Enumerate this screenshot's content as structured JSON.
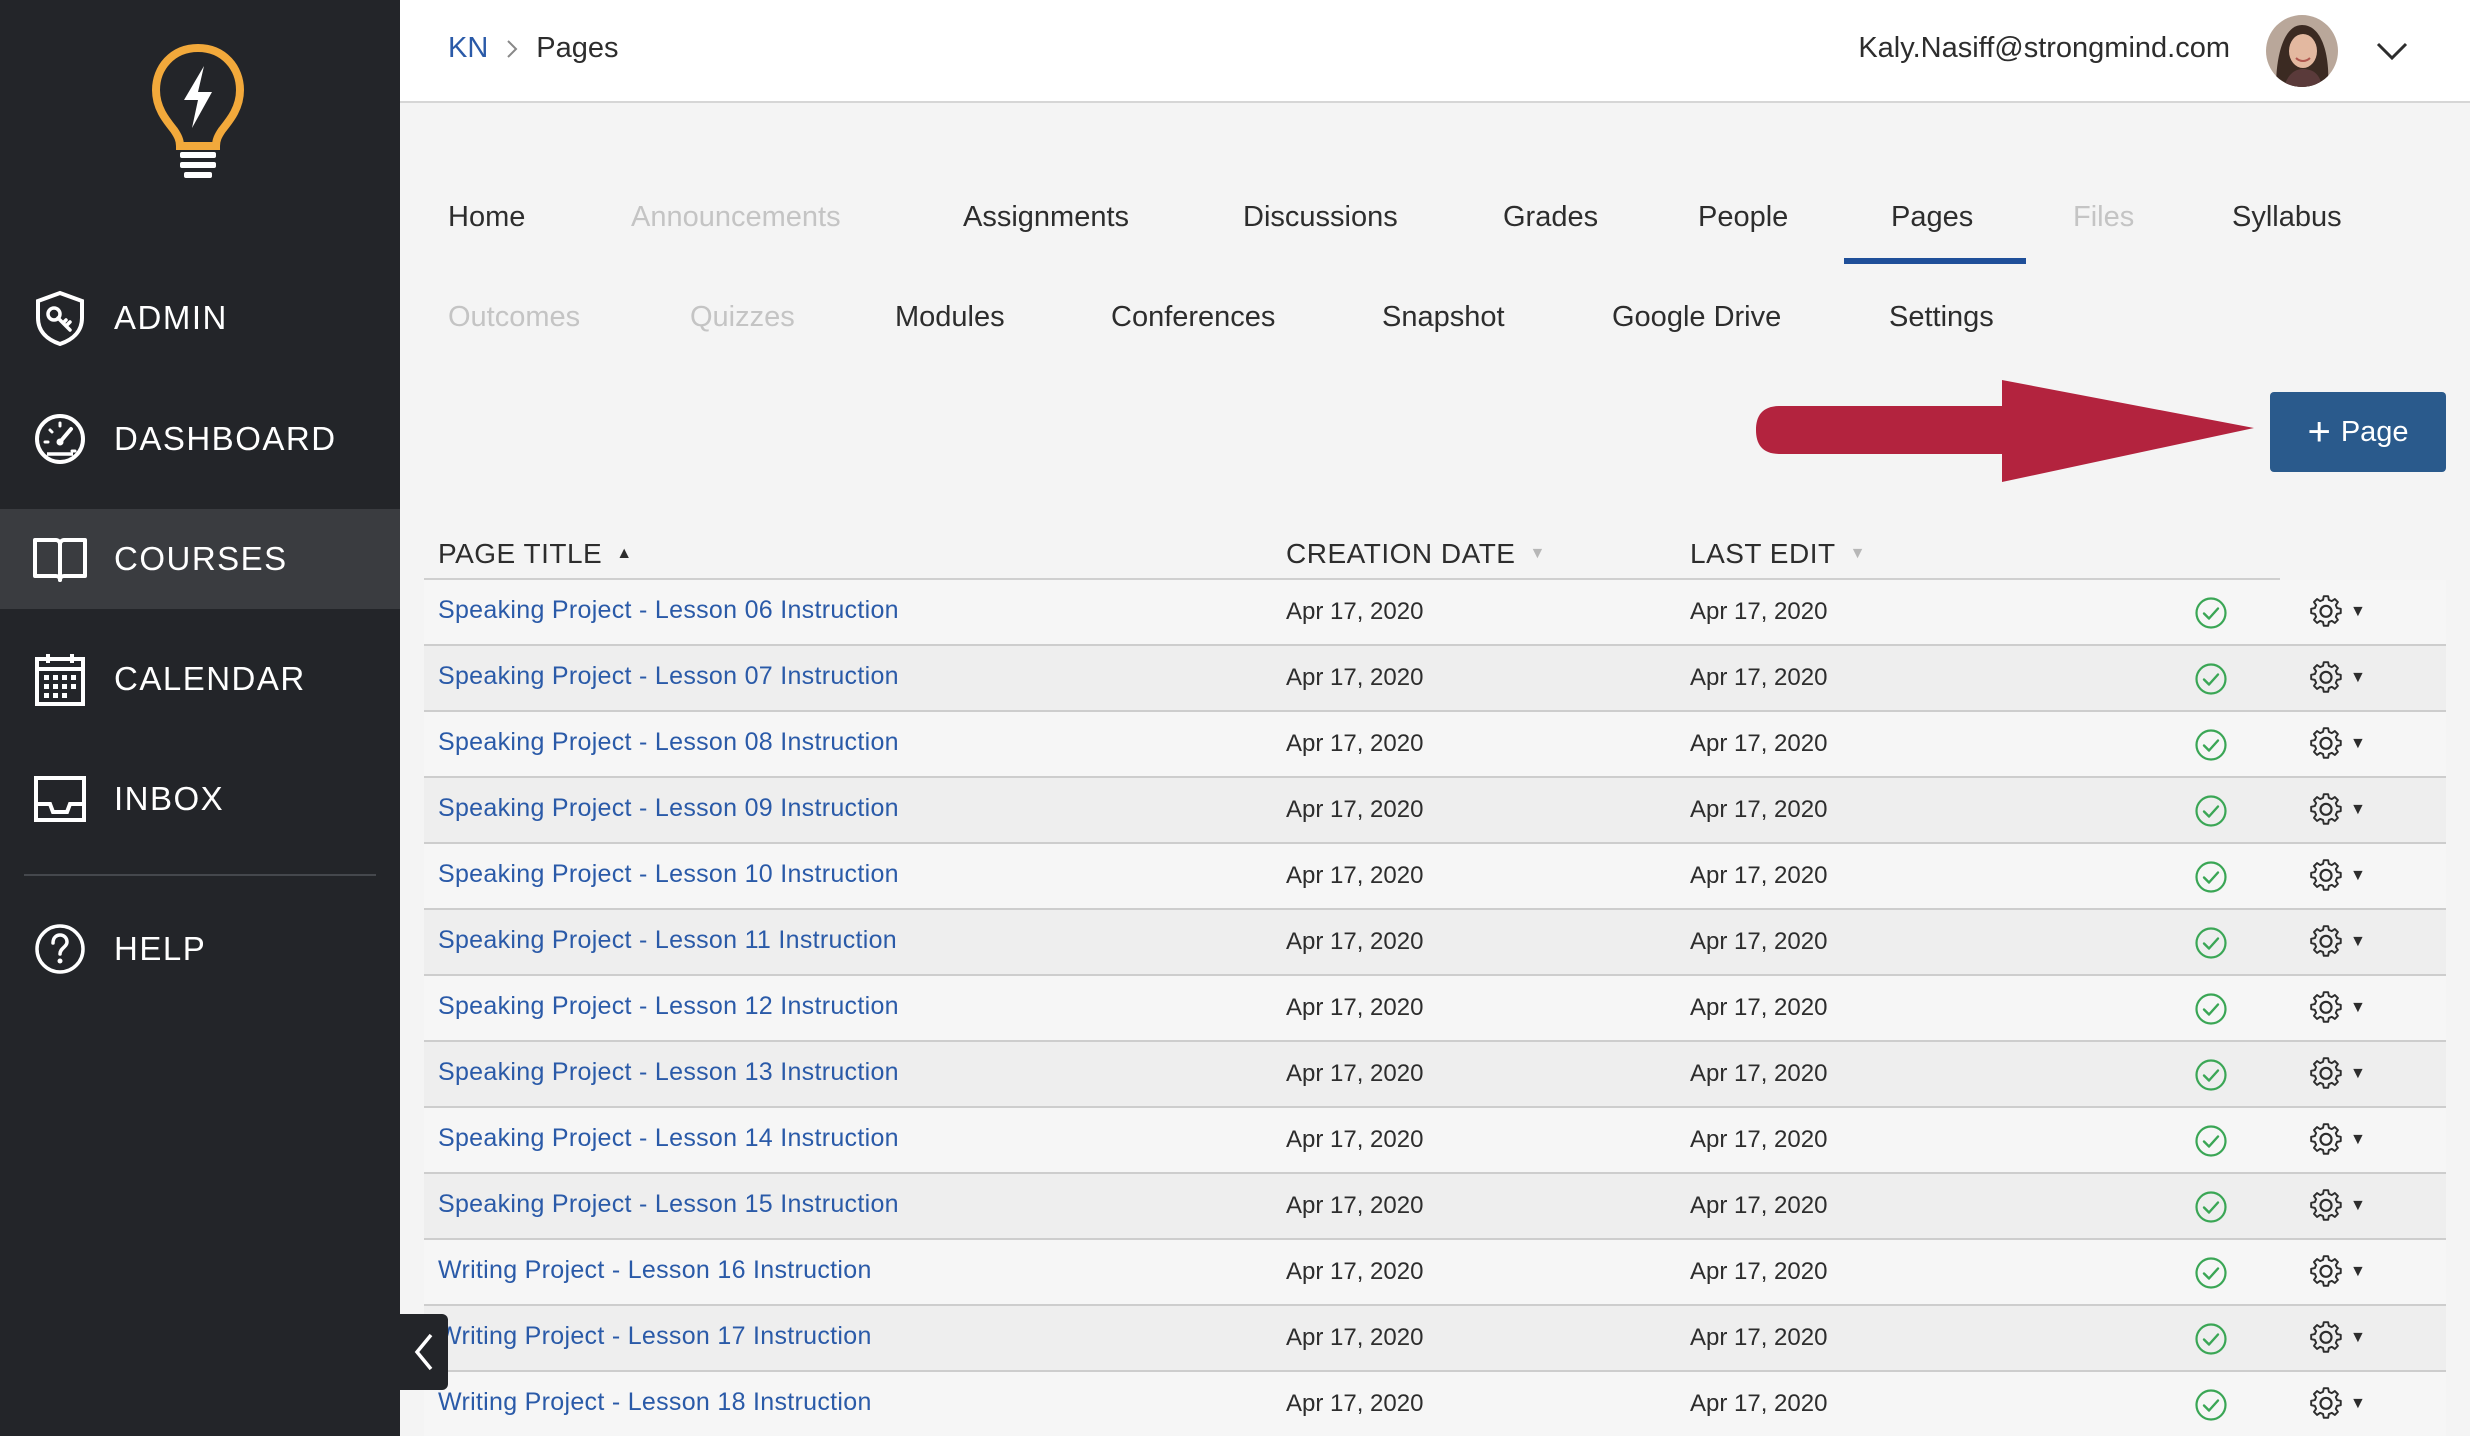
{
  "sidebar": {
    "items": [
      {
        "label": "ADMIN",
        "icon": "shield-key-icon"
      },
      {
        "label": "DASHBOARD",
        "icon": "speedometer-icon"
      },
      {
        "label": "COURSES",
        "icon": "book-icon",
        "active": true
      },
      {
        "label": "CALENDAR",
        "icon": "calendar-icon"
      },
      {
        "label": "INBOX",
        "icon": "inbox-tray-icon"
      },
      {
        "label": "HELP",
        "icon": "question-circle-icon"
      }
    ]
  },
  "header": {
    "breadcrumb": {
      "course": "KN",
      "current": "Pages"
    },
    "user_email": "Kaly.Nasiff@strongmind.com"
  },
  "tabs": [
    {
      "label": "Home",
      "disabled": false
    },
    {
      "label": "Announcements",
      "disabled": true
    },
    {
      "label": "Assignments",
      "disabled": false
    },
    {
      "label": "Discussions",
      "disabled": false
    },
    {
      "label": "Grades",
      "disabled": false
    },
    {
      "label": "People",
      "disabled": false
    },
    {
      "label": "Pages",
      "disabled": false,
      "active": true
    },
    {
      "label": "Files",
      "disabled": true
    },
    {
      "label": "Syllabus",
      "disabled": false
    },
    {
      "label": "Outcomes",
      "disabled": true
    },
    {
      "label": "Quizzes",
      "disabled": true
    },
    {
      "label": "Modules",
      "disabled": false
    },
    {
      "label": "Conferences",
      "disabled": false
    },
    {
      "label": "Snapshot",
      "disabled": false
    },
    {
      "label": "Google Drive",
      "disabled": false
    },
    {
      "label": "Settings",
      "disabled": false
    }
  ],
  "add_page": {
    "label": "Page"
  },
  "table": {
    "columns": {
      "title": "PAGE TITLE",
      "created": "CREATION DATE",
      "edited": "LAST EDIT"
    },
    "rows": [
      {
        "title": "Speaking Project - Lesson 06 Instruction",
        "created": "Apr 17, 2020",
        "edited": "Apr 17, 2020"
      },
      {
        "title": "Speaking Project - Lesson 07 Instruction",
        "created": "Apr 17, 2020",
        "edited": "Apr 17, 2020"
      },
      {
        "title": "Speaking Project - Lesson 08 Instruction",
        "created": "Apr 17, 2020",
        "edited": "Apr 17, 2020"
      },
      {
        "title": "Speaking Project - Lesson 09 Instruction",
        "created": "Apr 17, 2020",
        "edited": "Apr 17, 2020"
      },
      {
        "title": "Speaking Project - Lesson 10 Instruction",
        "created": "Apr 17, 2020",
        "edited": "Apr 17, 2020"
      },
      {
        "title": "Speaking Project - Lesson 11 Instruction",
        "created": "Apr 17, 2020",
        "edited": "Apr 17, 2020"
      },
      {
        "title": "Speaking Project - Lesson 12 Instruction",
        "created": "Apr 17, 2020",
        "edited": "Apr 17, 2020"
      },
      {
        "title": "Speaking Project - Lesson 13 Instruction",
        "created": "Apr 17, 2020",
        "edited": "Apr 17, 2020"
      },
      {
        "title": "Speaking Project - Lesson 14 Instruction",
        "created": "Apr 17, 2020",
        "edited": "Apr 17, 2020"
      },
      {
        "title": "Speaking Project - Lesson 15 Instruction",
        "created": "Apr 17, 2020",
        "edited": "Apr 17, 2020"
      },
      {
        "title": "Writing Project - Lesson 16 Instruction",
        "created": "Apr 17, 2020",
        "edited": "Apr 17, 2020"
      },
      {
        "title": "Writing Project - Lesson 17 Instruction",
        "created": "Apr 17, 2020",
        "edited": "Apr 17, 2020"
      },
      {
        "title": "Writing Project - Lesson 18 Instruction",
        "created": "Apr 17, 2020",
        "edited": "Apr 17, 2020"
      }
    ]
  },
  "colors": {
    "sidebar_bg": "#232529",
    "sidebar_active": "#3a3c40",
    "logo_yellow": "#f2a93b",
    "link_blue": "#2a5aa8",
    "tab_underline": "#1f4f99",
    "button_blue": "#2a5a8c",
    "arrow_red": "#b3233e",
    "published_green": "#3aa655"
  }
}
